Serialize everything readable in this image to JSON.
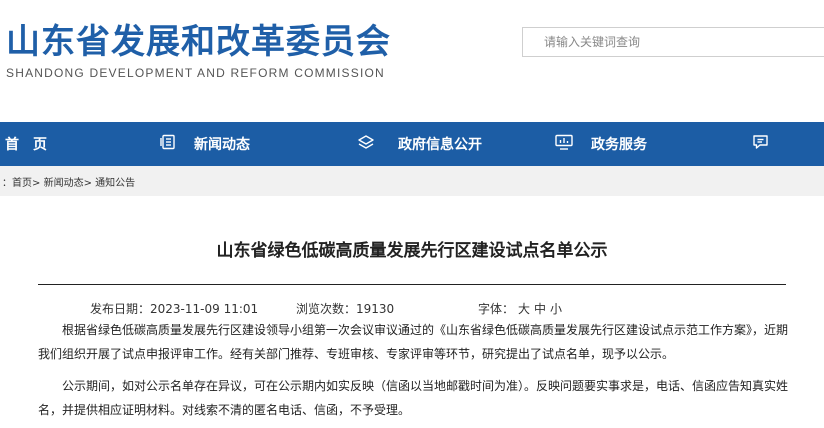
{
  "header": {
    "logo_cn": "山东省发展和改革委员会",
    "logo_en": "SHANDONG DEVELOPMENT AND REFORM COMMISSION",
    "search_placeholder": "请输入关键词查询"
  },
  "nav": {
    "items": [
      {
        "label": "首　页",
        "icon": ""
      },
      {
        "label": "新闻动态",
        "icon": "news-list-icon"
      },
      {
        "label": "政府信息公开",
        "icon": "layers-icon"
      },
      {
        "label": "政务服务",
        "icon": "chart-screen-icon"
      },
      {
        "label": "",
        "icon": "chat-bubble-icon"
      }
    ],
    "brand_color": "#1c5da5"
  },
  "breadcrumb": {
    "prefix": "：",
    "items": [
      "首页",
      "新闻动态",
      "通知公告"
    ],
    "separator": ">"
  },
  "article": {
    "title": "山东省绿色低碳高质量发展先行区建设试点名单公示",
    "meta": {
      "date_label": "发布日期：",
      "date_value": "2023-11-09 11:01",
      "views_label": "浏览次数：",
      "views_value": "19130",
      "font_label": "字体：",
      "font_sizes": [
        "大",
        "中",
        "小"
      ]
    },
    "paragraphs": [
      "根据省绿色低碳高质量发展先行区建设领导小组第一次会议审议通过的《山东省绿色低碳高质量发展先行区建设试点示范工作方案》，近期我们组织开展了试点申报评审工作。经有关部门推荐、专班审核、专家评审等环节，研究提出了试点名单，现予以公示。",
      "公示期间，如对公示名单存在异议，可在公示期内如实反映（信函以当地邮戳时间为准）。反映问题要实事求是，电话、信函应告知真实姓名，并提供相应证明材料。对线索不清的匿名电话、信函，不予受理。"
    ]
  }
}
